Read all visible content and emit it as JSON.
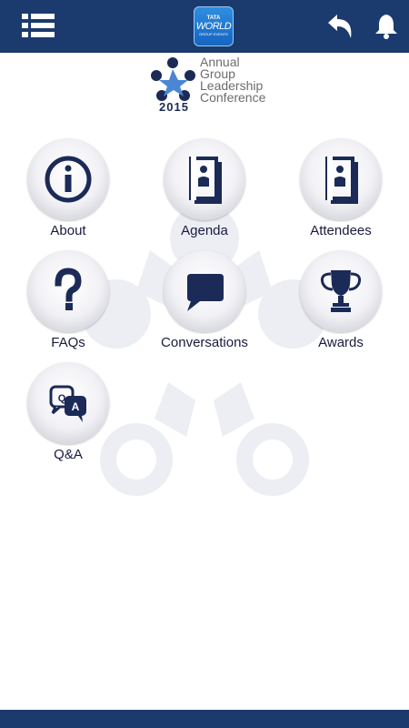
{
  "header": {
    "logo": {
      "line1": "TATA",
      "line2": "WORLD",
      "line3": "GROUP EVENTS"
    },
    "icons": [
      "menu-icon",
      "back-arrow-icon",
      "bell-icon"
    ],
    "background": "#1b3a6e"
  },
  "conference": {
    "year": "2015",
    "title_lines": [
      "Annual",
      "Group",
      "Leadership",
      "Conference"
    ]
  },
  "tiles": [
    {
      "label": "About",
      "icon": "info-icon"
    },
    {
      "label": "Agenda",
      "icon": "agenda-book-icon"
    },
    {
      "label": "Attendees",
      "icon": "attendees-book-icon"
    },
    {
      "label": "FAQs",
      "icon": "question-mark-icon"
    },
    {
      "label": "Conversations",
      "icon": "chat-bubble-icon"
    },
    {
      "label": "Awards",
      "icon": "trophy-icon"
    },
    {
      "label": "Q&A",
      "icon": "qa-bubbles-icon"
    }
  ],
  "colors": {
    "brand": "#1b3a6e",
    "icon": "#1b2a57",
    "watermark": "#eceef4"
  }
}
